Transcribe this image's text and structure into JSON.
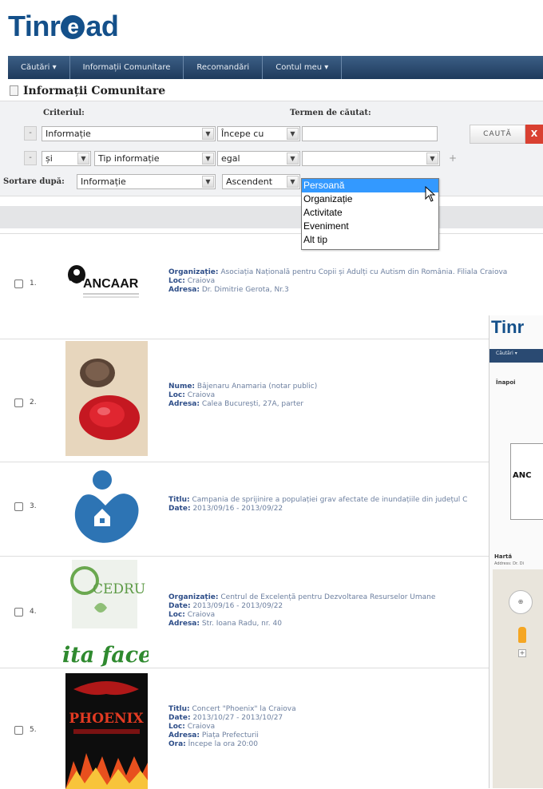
{
  "app": {
    "logo_left": "Tinr",
    "logo_mark": "e",
    "logo_right": "ad"
  },
  "nav": [
    {
      "label": "Căutări ▾"
    },
    {
      "label": "Informații Comunitare"
    },
    {
      "label": "Recomandări"
    },
    {
      "label": "Contul meu ▾"
    }
  ],
  "page": {
    "title": "Informații Comunitare"
  },
  "search": {
    "criteria_label": "Criteriul:",
    "term_label": "Termen de căutat:",
    "row1": {
      "remove": "-",
      "field": "Informație",
      "operator": "Începe cu",
      "term": ""
    },
    "row2": {
      "remove": "-",
      "logic": "și",
      "field": "Tip informație",
      "operator": "egal",
      "value": "",
      "add": "+"
    },
    "sort_label": "Sortare după:",
    "sort_field": "Informație",
    "sort_order": "Ascendent",
    "search_button": "CAUTĂ",
    "close_button": "X"
  },
  "dropdown": {
    "options": [
      "Persoană",
      "Organizație",
      "Activitate",
      "Eveniment",
      "Alt tip"
    ],
    "selected_index": 0
  },
  "results": [
    {
      "num": "1.",
      "logo_text": "ANCAAR",
      "fields": [
        {
          "key": "Organizație:",
          "value": "Asociația Națională pentru Copii și Adulți cu Autism din România. Filiala Craiova"
        },
        {
          "key": "Loc:",
          "value": "Craiova"
        },
        {
          "key": "Adresa:",
          "value": "Dr. Dimitrie Gerota, Nr.3"
        }
      ]
    },
    {
      "num": "2.",
      "fields": [
        {
          "key": "Nume:",
          "value": "Bâjenaru Anamaria (notar public)"
        },
        {
          "key": "Loc:",
          "value": "Craiova"
        },
        {
          "key": "Adresa:",
          "value": "Calea București, 27A, parter"
        }
      ]
    },
    {
      "num": "3.",
      "fields": [
        {
          "key": "Titlu:",
          "value": "Campania de sprijinire a populației grav afectate de inundațiile din județul C"
        },
        {
          "key": "Date:",
          "value": "2013/09/16 - 2013/09/22"
        }
      ]
    },
    {
      "num": "4.",
      "logo_text": "CEDRU",
      "logo_tagline": "ita face c",
      "fields": [
        {
          "key": "Organizație:",
          "value": "Centrul de Excelență pentru Dezvoltarea Resurselor Umane"
        },
        {
          "key": "Date:",
          "value": "2013/09/16 - 2013/09/22"
        },
        {
          "key": "Loc:",
          "value": "Craiova"
        },
        {
          "key": "Adresa:",
          "value": "Str. Ioana Radu, nr. 40"
        }
      ]
    },
    {
      "num": "5.",
      "poster_text": "PHOENIX",
      "fields": [
        {
          "key": "Titlu:",
          "value": "Concert \"Phoenix\" la Craiova"
        },
        {
          "key": "Date:",
          "value": "2013/10/27 - 2013/10/27"
        },
        {
          "key": "Loc:",
          "value": "Craiova"
        },
        {
          "key": "Adresa:",
          "value": "Piața Prefecturii"
        },
        {
          "key": "Ora:",
          "value": "Începe la ora 20:00"
        }
      ]
    }
  ],
  "overlay": {
    "logo": "Tinr",
    "nav_label": "Căutări ▾",
    "back": "Înapoi",
    "card_text": "ANC",
    "map_label": "Hartă",
    "addr": "Address: Dr. Di"
  },
  "colors": {
    "brand": "#14508a",
    "nav": "#2a4a72",
    "accent_red": "#d94031",
    "selection": "#3399ff"
  }
}
